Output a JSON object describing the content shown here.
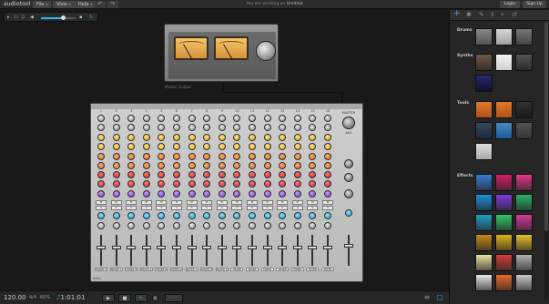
{
  "app": {
    "logo": "audiotool"
  },
  "menu": {
    "file": "File",
    "view": "View",
    "help": "Help"
  },
  "status": {
    "prefix": "You are working on",
    "doc": "Untitled"
  },
  "auth": {
    "login": "Login",
    "signup": "Sign Up"
  },
  "master": {
    "label": "Master Output"
  },
  "mixer": {
    "channel_numbers": [
      "1",
      "2",
      "3",
      "4",
      "5",
      "6",
      "7",
      "8",
      "9",
      "10",
      "11",
      "12",
      "13",
      "14",
      "15",
      "16"
    ],
    "channel_names": [
      "MIXER 1",
      "MIXER 2",
      "MIXER 3",
      "MIXER 4",
      "MIXER 5",
      "MIXER 6",
      "MIXER 7",
      "MIXER 8",
      "MIXER 9",
      "MIXER 10",
      "MIXER 11",
      "MIXER 12",
      "MIXER 13",
      "MIXER 14",
      "MIXER 15",
      "MIXER 16"
    ],
    "mute_label": "M",
    "solo_label": "S",
    "aux_label": "AUX",
    "master_label": "MASTER",
    "footer": "Mixer"
  },
  "panel": {
    "sections": {
      "drums": "Drums",
      "synths": "Synths",
      "tools": "Tools",
      "effects": "Effects"
    }
  },
  "transport": {
    "bpm": "120.00",
    "signature": "4/4",
    "zoom": "60%",
    "position": "1:01:01"
  },
  "colors": {
    "accent": "#2eb7e7",
    "effects_tiles": [
      "#3a7bd5",
      "#d4206e",
      "#e23a8a",
      "#1e8ed6",
      "#7c3cd6",
      "#2bb26a",
      "#1ea0c2",
      "#36c46a",
      "#d63c9a",
      "#c48a1a",
      "#e0b21e",
      "#e8c22a",
      "#e8e0a0",
      "#d43c3c",
      "#b0b0b0",
      "#e6e6e6",
      "#e66a2a",
      "#c8c8c8"
    ]
  }
}
